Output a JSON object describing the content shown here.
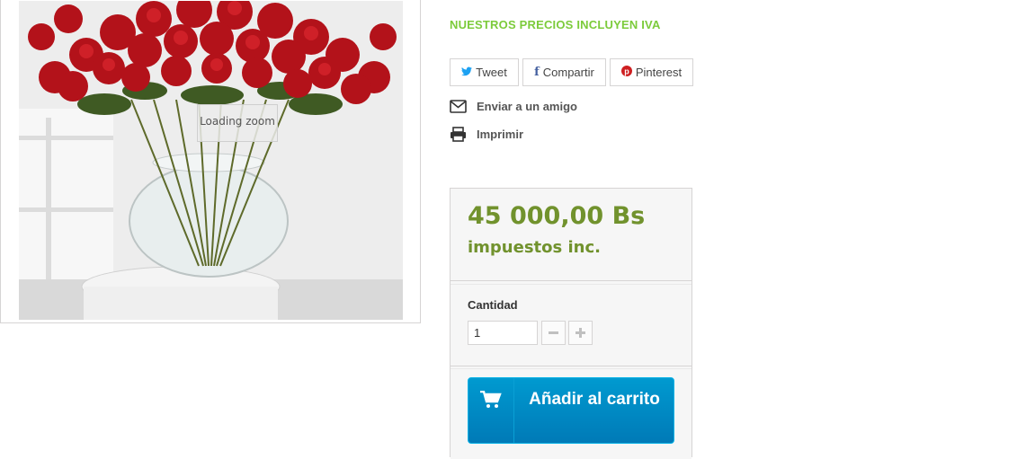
{
  "product_image": {
    "zoom_loading_text": "Loading zoom"
  },
  "tax_note": "NUESTROS PRECIOS INCLUYEN IVA",
  "share": {
    "tweet": "Tweet",
    "facebook": "Compartir",
    "pinterest": "Pinterest"
  },
  "actions": {
    "send_friend": "Enviar a un amigo",
    "print": "Imprimir"
  },
  "buy_box": {
    "price": "45 000,00 Bs",
    "tax_included": "impuestos inc.",
    "quantity_label": "Cantidad",
    "quantity_value": "1",
    "add_to_cart": "Añadir al carrito"
  },
  "colors": {
    "green_note": "#7ccb3b",
    "price_green": "#71922d",
    "cart_blue": "#009ad0"
  },
  "icons": [
    "twitter-icon",
    "facebook-icon",
    "pinterest-icon",
    "envelope-icon",
    "printer-icon",
    "minus-icon",
    "plus-icon",
    "cart-icon"
  ]
}
